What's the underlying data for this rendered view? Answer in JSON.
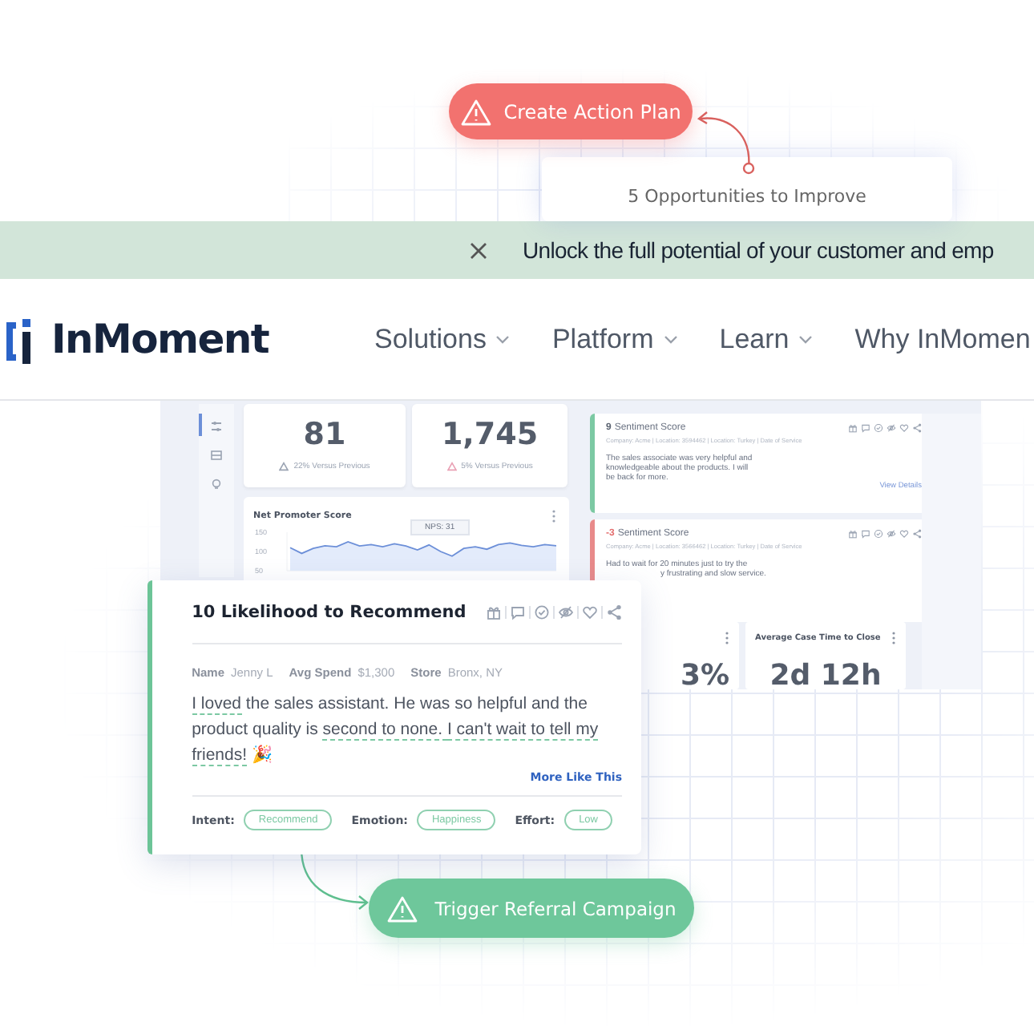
{
  "top": {
    "action_button": "Create Action Plan",
    "opportunities_card": "5 Opportunities to Improve"
  },
  "banner": {
    "message": "Unlock the full potential of your customer and emp"
  },
  "nav": {
    "brand": "InMoment",
    "items": [
      {
        "label": "Solutions",
        "dropdown": true
      },
      {
        "label": "Platform",
        "dropdown": true
      },
      {
        "label": "Learn",
        "dropdown": true
      },
      {
        "label": "Why InMomen",
        "dropdown": false
      }
    ]
  },
  "dashboard": {
    "kpis": [
      {
        "value": "81",
        "delta": "22% Versus Previous",
        "color": "#9aa3b2"
      },
      {
        "value": "1,745",
        "delta": "5% Versus Previous",
        "color": "#e9a0b4"
      }
    ],
    "nps_chart": {
      "tooltip": "NPS: 31",
      "chart_data": {
        "type": "area",
        "title": "Net Promoter Score",
        "ylim": [
          50,
          150
        ],
        "yticks": [
          50,
          100,
          150
        ],
        "series": [
          {
            "color": "#6c8fd8",
            "values": [
              110,
              95,
              108,
              115,
              112,
              125,
              114,
              118,
              112,
              120,
              114,
              104,
              117,
              100,
              88,
              108,
              112,
              106,
              118,
              122,
              116,
              112,
              118,
              115
            ]
          }
        ]
      }
    },
    "sentiment_cards": [
      {
        "score": {
          "value": "9",
          "color": "#5a6270"
        },
        "label": "Sentiment Score",
        "color": "#7cc9a3",
        "meta": "Company: Acme | Location: 3594462 | Location: Turkey | Date of Service",
        "text_lines": [
          "The sales associate was very helpful and",
          "knowledgeable about the products. I will",
          "be back for more."
        ],
        "link": "View Details"
      },
      {
        "score": {
          "value": "-3",
          "color": "#e36c6c"
        },
        "label": "Sentiment Score",
        "color": "#e88a8a",
        "meta": "Company: Acme | Location: 3566462 | Location: Turkey | Date of Service",
        "text_lines": [
          "Had to wait for 20 minutes just to try the",
          "y frustrating and slow service."
        ]
      }
    ],
    "metric_cards": [
      {
        "value": "3%"
      },
      {
        "title": "Average Case Time to Close",
        "value": "2d 12h"
      }
    ]
  },
  "feedback_card": {
    "score": "10",
    "title": "Likelihood to Recommend",
    "color": "#6cc497",
    "fields": [
      {
        "label": "Name",
        "value": "Jenny L"
      },
      {
        "label": "Avg Spend",
        "value": "$1,300"
      },
      {
        "label": "Store",
        "value": "Bronx, NY"
      }
    ],
    "body": [
      {
        "text": "I loved",
        "highlighted": true
      },
      {
        "text": " the sales assistant. He was so helpful and the product quality is ",
        "highlighted": false
      },
      {
        "text": "second to none. ",
        "highlighted": true
      },
      {
        "text": "I can't wait to tell my friends!",
        "highlighted": true
      },
      {
        "text": " 🎉",
        "highlighted": false
      }
    ],
    "link": "More Like This",
    "tags": [
      {
        "label": "Intent:",
        "value": "Recommend"
      },
      {
        "label": "Emotion:",
        "value": "Happiness"
      },
      {
        "label": "Effort:",
        "value": "Low"
      }
    ]
  },
  "trigger_button": "Trigger Referral Campaign"
}
